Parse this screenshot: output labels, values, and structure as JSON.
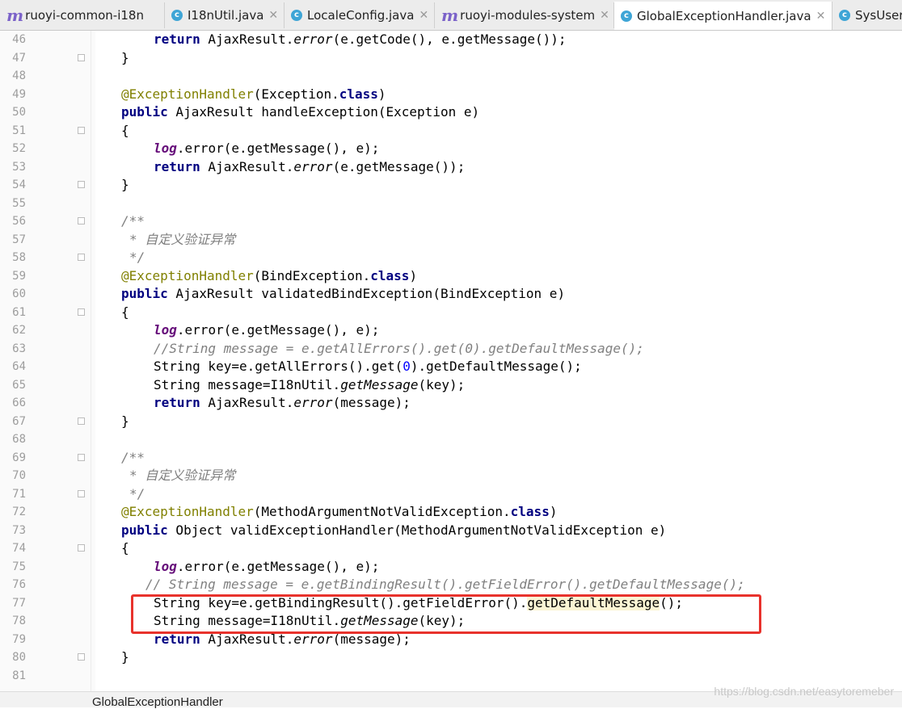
{
  "tabs": [
    {
      "label": "ruoyi-common-i18n",
      "icon": "module-icon"
    },
    {
      "label": "I18nUtil.java",
      "icon": "class-icon"
    },
    {
      "label": "LocaleConfig.java",
      "icon": "class-icon"
    },
    {
      "label": "ruoyi-modules-system",
      "icon": "module-icon"
    },
    {
      "label": "GlobalExceptionHandler.java",
      "icon": "class-icon",
      "active": true
    },
    {
      "label": "SysUser",
      "icon": "class-icon"
    }
  ],
  "lines": [
    {
      "n": "46",
      "text": "return AjaxResult.error(e.getCode(), e.getMessage());"
    },
    {
      "n": "47",
      "text": "}"
    },
    {
      "n": "48",
      "text": ""
    },
    {
      "n": "49",
      "text": "@ExceptionHandler(Exception.class)"
    },
    {
      "n": "50",
      "text": "public AjaxResult handleException(Exception e)"
    },
    {
      "n": "51",
      "text": "{"
    },
    {
      "n": "52",
      "text": "log.error(e.getMessage(), e);"
    },
    {
      "n": "53",
      "text": "return AjaxResult.error(e.getMessage());"
    },
    {
      "n": "54",
      "text": "}"
    },
    {
      "n": "55",
      "text": ""
    },
    {
      "n": "56",
      "text": "/**"
    },
    {
      "n": "57",
      "text": "* 自定义验证异常"
    },
    {
      "n": "58",
      "text": "*/"
    },
    {
      "n": "59",
      "text": "@ExceptionHandler(BindException.class)"
    },
    {
      "n": "60",
      "text": "public AjaxResult validatedBindException(BindException e)"
    },
    {
      "n": "61",
      "text": "{"
    },
    {
      "n": "62",
      "text": "log.error(e.getMessage(), e);"
    },
    {
      "n": "63",
      "text": "//String message = e.getAllErrors().get(0).getDefaultMessage();"
    },
    {
      "n": "64",
      "text": "String key=e.getAllErrors().get(0).getDefaultMessage();"
    },
    {
      "n": "65",
      "text": "String message=I18nUtil.getMessage(key);"
    },
    {
      "n": "66",
      "text": "return AjaxResult.error(message);"
    },
    {
      "n": "67",
      "text": "}"
    },
    {
      "n": "68",
      "text": ""
    },
    {
      "n": "69",
      "text": "/**"
    },
    {
      "n": "70",
      "text": "* 自定义验证异常"
    },
    {
      "n": "71",
      "text": "*/"
    },
    {
      "n": "72",
      "text": "@ExceptionHandler(MethodArgumentNotValidException.class)"
    },
    {
      "n": "73",
      "text": "public Object validExceptionHandler(MethodArgumentNotValidException e)"
    },
    {
      "n": "74",
      "text": "{"
    },
    {
      "n": "75",
      "text": "log.error(e.getMessage(), e);"
    },
    {
      "n": "76",
      "text": "// String message = e.getBindingResult().getFieldError().getDefaultMessage();"
    },
    {
      "n": "77",
      "text": "String key=e.getBindingResult().getFieldError().getDefaultMessage();"
    },
    {
      "n": "78",
      "text": "String message=I18nUtil.getMessage(key);"
    },
    {
      "n": "79",
      "text": "return AjaxResult.error(message);"
    },
    {
      "n": "80",
      "text": "}"
    },
    {
      "n": "81",
      "text": ""
    }
  ],
  "status": {
    "breadcrumb": "GlobalExceptionHandler"
  },
  "watermark": "https://blog.csdn.net/easytoremeber",
  "colors": {
    "keyword": "#000080",
    "annotation": "#808000",
    "comment": "#808080",
    "static_method": "#660e7a",
    "number": "#0000ff",
    "highlight_box": "#e8322c"
  }
}
